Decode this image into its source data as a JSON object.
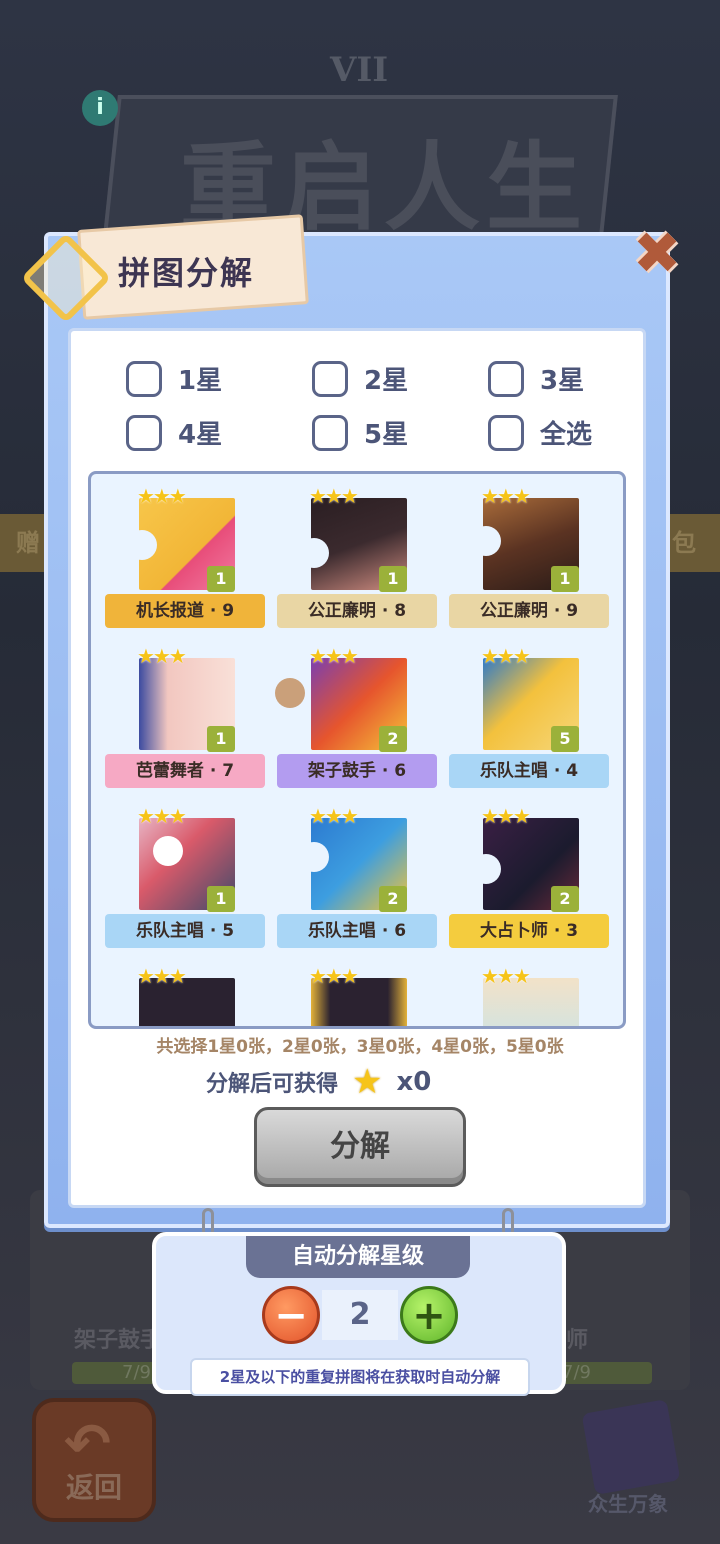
{
  "background": {
    "title_text": "重启人生",
    "roman": "VII",
    "info_icon": "info-icon",
    "left_bar": "赠",
    "right_bar": "包",
    "card_left_label": "架子鼓手",
    "card_right_label": "师",
    "progress_left": "7/9",
    "progress_right": "7/9",
    "back_label": "返回",
    "book_label": "众生万象"
  },
  "dialog": {
    "title": "拼图分解",
    "close_icon": "close-icon",
    "filters": [
      {
        "label": "1星"
      },
      {
        "label": "2星"
      },
      {
        "label": "3星"
      },
      {
        "label": "4星"
      },
      {
        "label": "5星"
      },
      {
        "label": "全选"
      }
    ],
    "pieces": [
      {
        "name": "机长报道 · 9",
        "count": "1",
        "banner_color": "#f0b43a"
      },
      {
        "name": "公正廉明 · 8",
        "count": "1",
        "banner_color": "#e9d6a4"
      },
      {
        "name": "公正廉明 · 9",
        "count": "1",
        "banner_color": "#e9d6a4"
      },
      {
        "name": "芭蕾舞者 · 7",
        "count": "1",
        "banner_color": "#f6a9c4"
      },
      {
        "name": "架子鼓手 · 6",
        "count": "2",
        "banner_color": "#b39cf0"
      },
      {
        "name": "乐队主唱 · 4",
        "count": "5",
        "banner_color": "#a9d6f6"
      },
      {
        "name": "乐队主唱 · 5",
        "count": "1",
        "banner_color": "#a9d6f6"
      },
      {
        "name": "乐队主唱 · 6",
        "count": "2",
        "banner_color": "#a9d6f6"
      },
      {
        "name": "大占卜师 · 3",
        "count": "2",
        "banner_color": "#f4cc3e"
      }
    ],
    "summary": "共选择1星0张，2星0张，3星0张，4星0张，5星0张",
    "gain_label": "分解后可获得",
    "gain_value": "x0",
    "decompose_label": "分解"
  },
  "auto": {
    "title": "自动分解星级",
    "minus": "−",
    "plus": "+",
    "level": "2",
    "hint": "2星及以下的重复拼图将在获取时自动分解"
  }
}
